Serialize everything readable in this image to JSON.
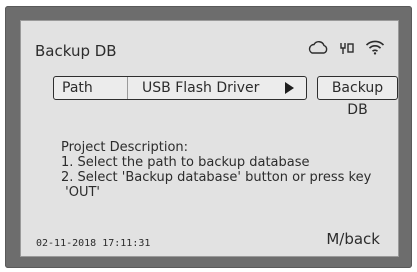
{
  "screen": {
    "title": "Backup DB",
    "status_icons": [
      "cloud-icon",
      "usb-icon",
      "wifi-icon"
    ]
  },
  "path": {
    "label": "Path",
    "value": "USB Flash Driver",
    "select_icon": "play-arrow-icon"
  },
  "backup_button": {
    "label": "Backup DB"
  },
  "description": {
    "heading": "Project Description:",
    "lines": [
      "1. Select the path to backup database",
      "2. Select 'Backup database' button or press key",
      " 'OUT'"
    ]
  },
  "footer": {
    "datetime": "02-11-2018  17:11:31",
    "back_label": "M/back"
  },
  "colors": {
    "frame": "#6d6d6d",
    "screen_bg": "#e2e2e2",
    "text": "#2c2c2c"
  }
}
